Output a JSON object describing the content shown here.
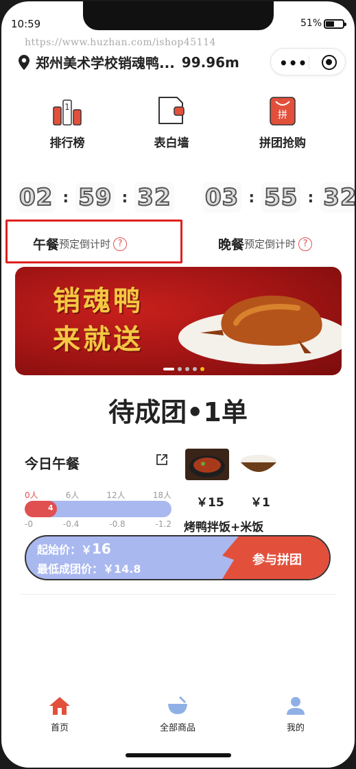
{
  "status": {
    "time": "10:59",
    "battery": "51%"
  },
  "watermark": "https://www.huzhan.com/ishop45114",
  "location": {
    "name": "郑州美术学校销魂鸭...",
    "distance": "99.96m"
  },
  "nav": [
    {
      "label": "排行榜",
      "icon": "ranking-icon"
    },
    {
      "label": "表白墙",
      "icon": "message-wall-icon"
    },
    {
      "label": "拼团抢购",
      "icon": "group-buy-icon"
    }
  ],
  "countdown": {
    "lunch": {
      "h": "02",
      "m": "59",
      "s": "32",
      "meal": "午餐",
      "sub": "预定倒计时",
      "help": "?"
    },
    "dinner": {
      "h": "03",
      "m": "55",
      "s": "32",
      "meal": "晚餐",
      "sub": "预定倒计时",
      "help": "?"
    }
  },
  "banner": {
    "line1": "销魂鸭",
    "line2": "来就送"
  },
  "pending": "待成团•1单",
  "today": {
    "title": "今日午餐",
    "scale_people": [
      "0人",
      "6人",
      "12人",
      "18人"
    ],
    "scale_discount": [
      "-0",
      "-0.4",
      "-0.8",
      "-1.2"
    ],
    "progress_count": "4",
    "progress_fraction": 0.22,
    "items": [
      {
        "price": "￥15",
        "image": "roast-duck-rice"
      },
      {
        "price": "￥1",
        "image": "rice-bowl"
      }
    ],
    "combo_name": "烤鸭拌饭+米饭",
    "start_price_label": "起始价：￥",
    "start_price": "16",
    "lowest_price": "最低成团价：￥14.8",
    "join_label": "参与拼团"
  },
  "tabs": [
    {
      "label": "首页",
      "active": true
    },
    {
      "label": "全部商品",
      "active": false
    },
    {
      "label": "我的",
      "active": false
    }
  ],
  "colors": {
    "accent": "#e2503c",
    "progress_bg": "#aab8f0",
    "banner": "#a01414",
    "banner_text": "#f5c842"
  }
}
